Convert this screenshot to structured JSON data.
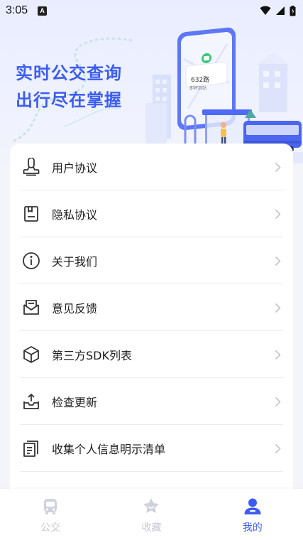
{
  "status_bar": {
    "time": "3:05",
    "notification_icon": "A"
  },
  "banner": {
    "slogan_line1": "实时公交查询",
    "slogan_line2": "出行尽在掌握",
    "phone_route": "632路",
    "phone_status": "即将到站"
  },
  "menu": {
    "items": [
      {
        "label": "用户协议",
        "icon": "user-agreement-icon"
      },
      {
        "label": "隐私协议",
        "icon": "privacy-icon"
      },
      {
        "label": "关于我们",
        "icon": "info-icon"
      },
      {
        "label": "意见反馈",
        "icon": "feedback-icon"
      },
      {
        "label": "第三方SDK列表",
        "icon": "sdk-box-icon"
      },
      {
        "label": "检查更新",
        "icon": "update-icon"
      },
      {
        "label": "收集个人信息明示清单",
        "icon": "document-list-icon"
      }
    ]
  },
  "bottom_nav": {
    "tabs": [
      {
        "label": "公交",
        "icon": "bus-icon",
        "active": false
      },
      {
        "label": "收藏",
        "icon": "favorite-star-icon",
        "active": false
      },
      {
        "label": "我的",
        "icon": "profile-icon",
        "active": true
      }
    ]
  },
  "colors": {
    "accent": "#3d5cf5",
    "slogan": "#3c5df2",
    "inactive_tab": "#c5c8d2",
    "divider": "#ececf0",
    "background": "#f4f5fb"
  }
}
